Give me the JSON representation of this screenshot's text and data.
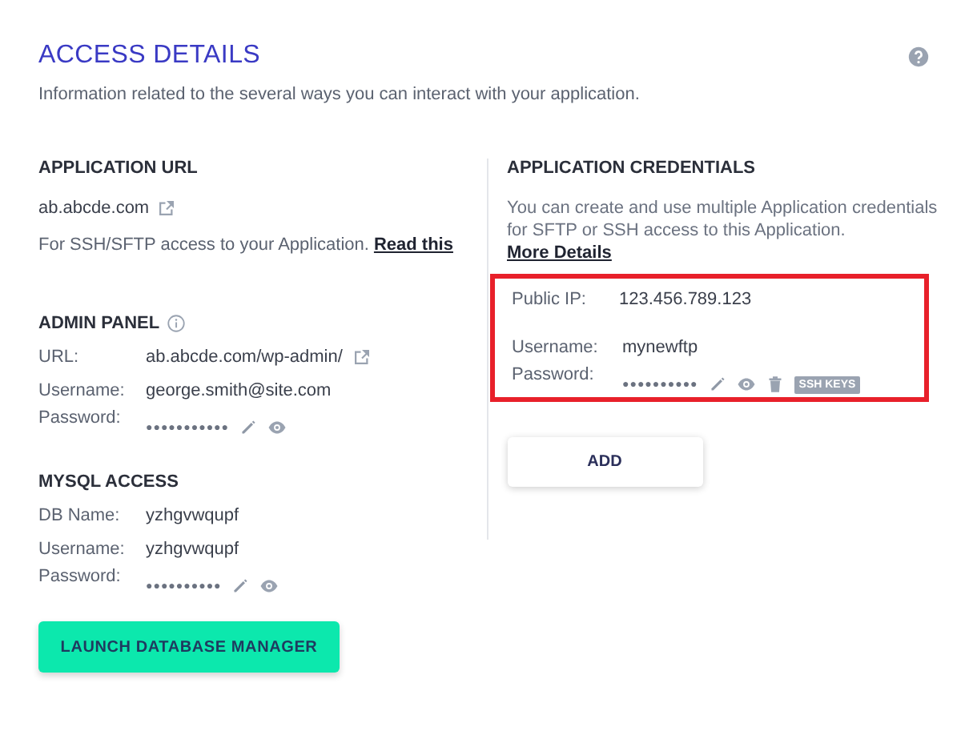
{
  "header": {
    "title": "ACCESS DETAILS",
    "description": "Information related to the several ways you can interact with your application."
  },
  "application_url": {
    "heading": "APPLICATION URL",
    "url": "ab.abcde.com",
    "note": "For SSH/SFTP access to your Application.",
    "link": "Read this"
  },
  "admin_panel": {
    "heading": "ADMIN PANEL",
    "rows": [
      {
        "kind": "link",
        "label": "URL:",
        "value": "ab.abcde.com/wp-admin/"
      },
      {
        "kind": "text",
        "label": "Username:",
        "value": "george.smith@site.com"
      },
      {
        "kind": "password",
        "label": "Password:",
        "value": "●●●●●●●●●●●"
      }
    ]
  },
  "mysql_access": {
    "heading": "MYSQL ACCESS",
    "rows": [
      {
        "kind": "text",
        "label": "DB Name:",
        "value": "yzhgvwqupf"
      },
      {
        "kind": "text",
        "label": "Username:",
        "value": "yzhgvwqupf"
      },
      {
        "kind": "password",
        "label": "Password:",
        "value": "●●●●●●●●●●"
      }
    ],
    "button": "LAUNCH DATABASE MANAGER"
  },
  "credentials": {
    "heading": "APPLICATION CREDENTIALS",
    "description": "You can create and use multiple Application credentials for SFTP or SSH access to this Application.",
    "link": "More Details",
    "public_ip": {
      "label": "Public IP:",
      "value": "123.456.789.123"
    },
    "rows": [
      {
        "kind": "text",
        "label": "Username:",
        "value": "mynewftp"
      },
      {
        "kind": "password",
        "label": "Password:",
        "value": "●●●●●●●●●●",
        "badge": "SSH KEYS"
      }
    ],
    "button": "ADD"
  }
}
